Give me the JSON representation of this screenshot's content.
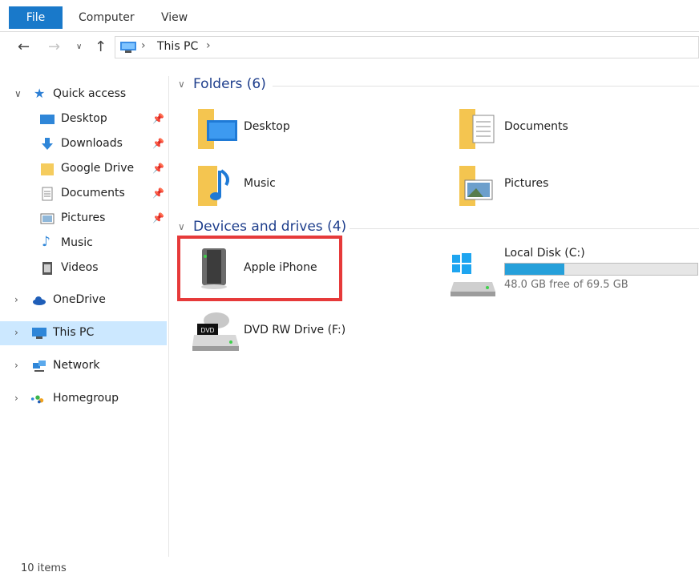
{
  "ribbon": {
    "tabs": [
      "File",
      "Computer",
      "View"
    ]
  },
  "address": {
    "crumb": "This PC"
  },
  "nav": {
    "quick_access": "Quick access",
    "quick_items": [
      "Desktop",
      "Downloads",
      "Google Drive",
      "Documents",
      "Pictures",
      "Music",
      "Videos"
    ],
    "onedrive": "OneDrive",
    "this_pc": "This PC",
    "network": "Network",
    "homegroup": "Homegroup"
  },
  "folders": {
    "header": "Folders (6)",
    "items": [
      "Desktop",
      "Documents",
      "Music",
      "Pictures"
    ]
  },
  "devices": {
    "header": "Devices and drives (4)",
    "iphone": "Apple iPhone",
    "local_disk": {
      "name": "Local Disk (C:)",
      "free_text": "48.0 GB free of 69.5 GB",
      "used_fraction": 0.31
    },
    "dvd": "DVD RW Drive (F:)"
  },
  "status": {
    "item_count": "10 items"
  },
  "colors": {
    "accent": "#1979ca",
    "selection": "#cce8ff",
    "highlight": "#e63a3a",
    "drive_bar": "#26a0da"
  }
}
